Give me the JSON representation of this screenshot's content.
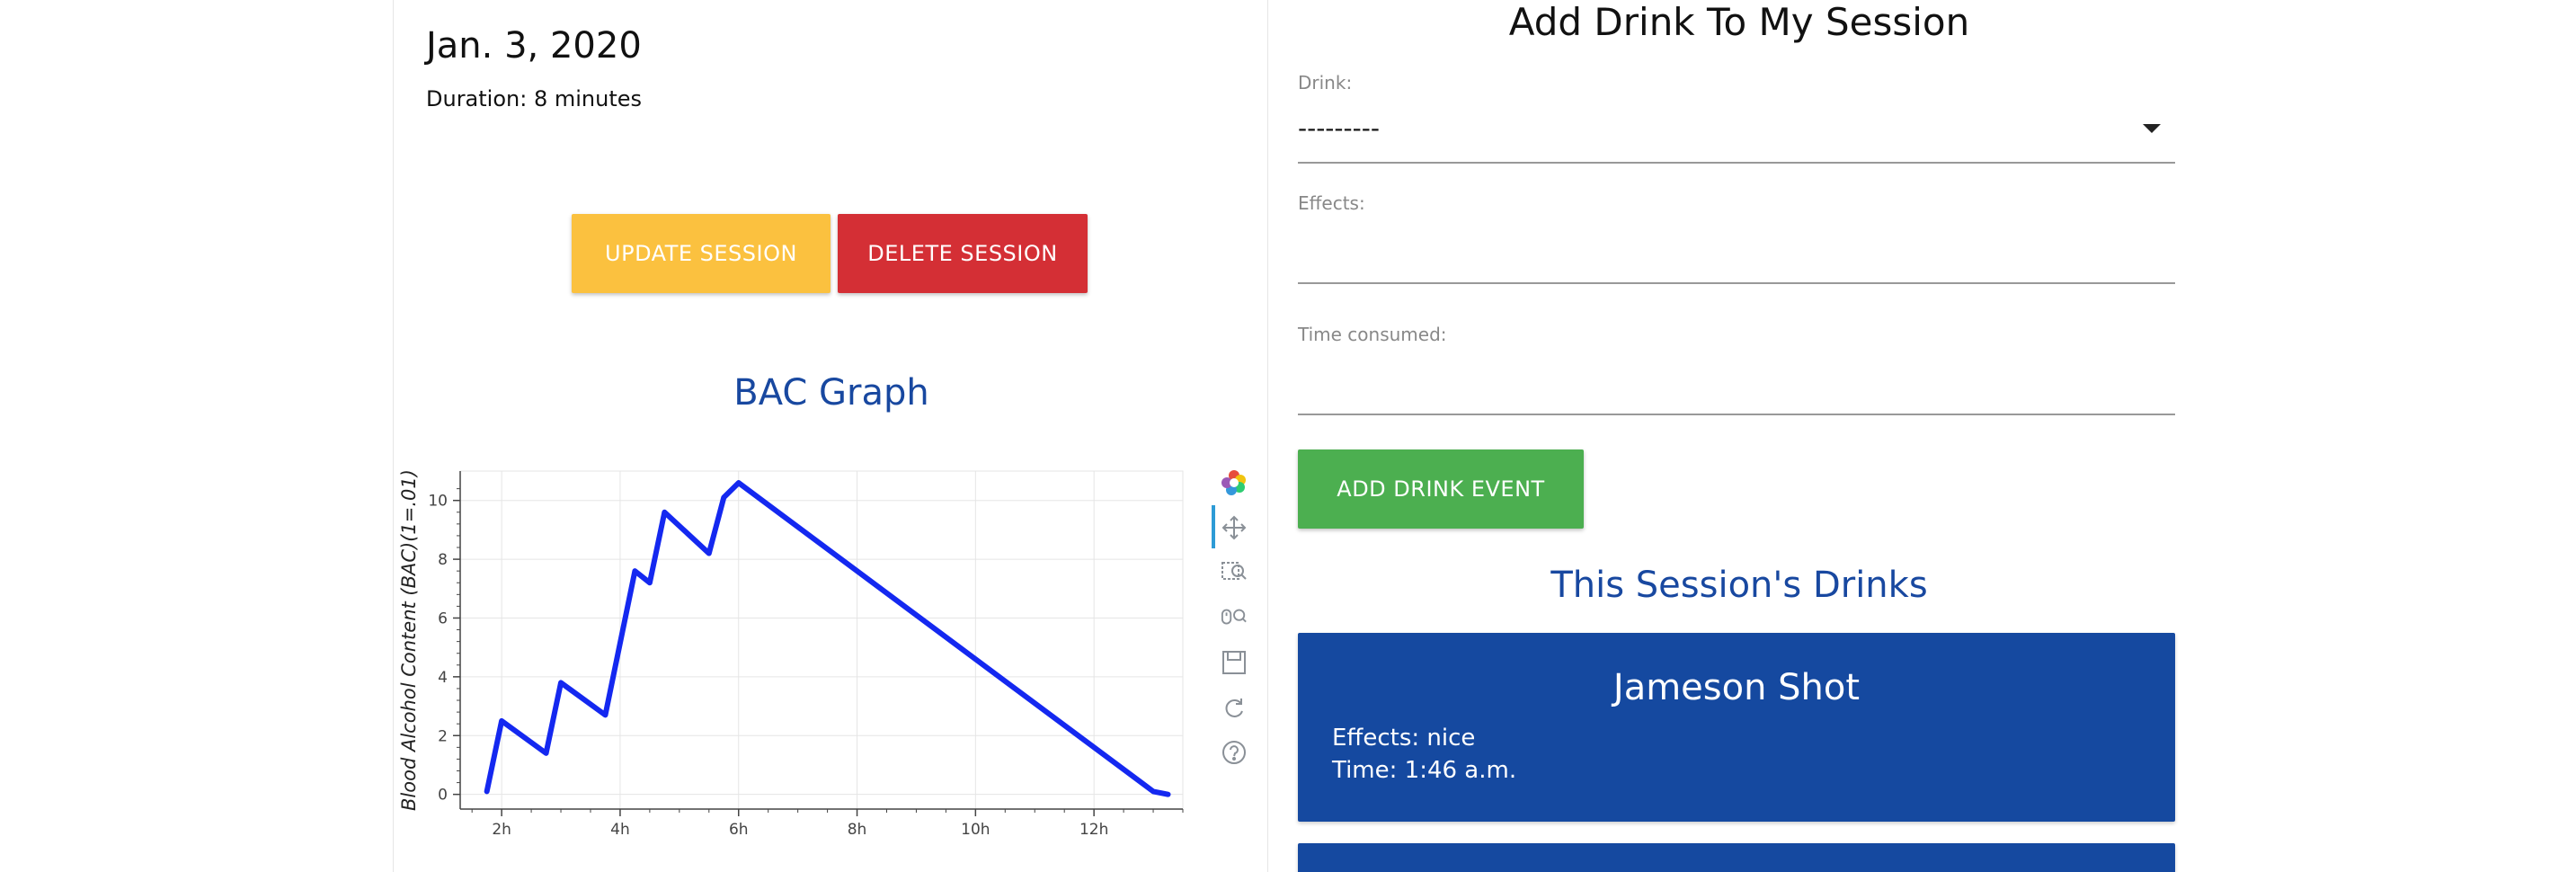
{
  "session": {
    "date": "Jan. 3, 2020",
    "duration": "Duration: 8 minutes",
    "update_label": "UPDATE SESSION",
    "delete_label": "DELETE SESSION"
  },
  "graph": {
    "title": "BAC Graph"
  },
  "chart_data": {
    "type": "line",
    "title": "",
    "xlabel": "",
    "ylabel": "Blood Alcohol Content (BAC)(1=.01)",
    "x_tick_labels": [
      "2h",
      "4h",
      "6h",
      "8h",
      "10h",
      "12h"
    ],
    "x_ticks": [
      2,
      4,
      6,
      8,
      10,
      12
    ],
    "y_ticks": [
      0,
      2,
      4,
      6,
      8,
      10
    ],
    "xlim": [
      1.3,
      13.5
    ],
    "ylim": [
      -0.5,
      11.0
    ],
    "grid": true,
    "series": [
      {
        "color": "#1428f0",
        "x": [
          1.75,
          2.0,
          2.75,
          3.0,
          3.75,
          4.25,
          4.5,
          4.75,
          5.5,
          5.75,
          6.0,
          13.0,
          13.25
        ],
        "y": [
          0.1,
          2.5,
          1.4,
          3.8,
          2.7,
          7.6,
          7.2,
          9.6,
          8.2,
          10.1,
          10.6,
          0.1,
          0.0
        ]
      }
    ]
  },
  "toolbar": {
    "icons": [
      "bokeh-logo-icon",
      "pan-icon",
      "box-zoom-icon",
      "wheel-zoom-icon",
      "save-icon",
      "reset-icon",
      "help-icon"
    ]
  },
  "form": {
    "title": "Add Drink To My Session",
    "drink_label": "Drink:",
    "drink_value": "---------",
    "effects_label": "Effects:",
    "effects_value": "",
    "time_label": "Time consumed:",
    "time_value": "",
    "add_label": "ADD DRINK EVENT"
  },
  "drinks": {
    "title": "This Session's Drinks",
    "items": [
      {
        "name": "Jameson Shot",
        "effects": "Effects: nice",
        "time": "Time: 1:46 a.m."
      }
    ]
  }
}
